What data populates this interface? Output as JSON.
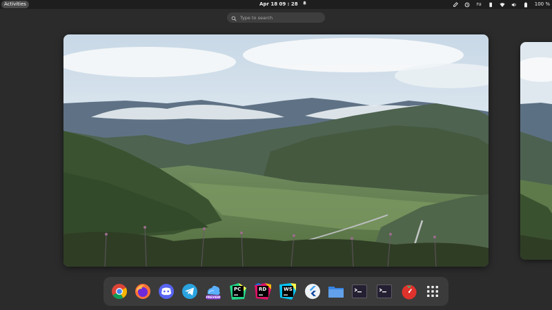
{
  "topbar": {
    "activities_label": "Activities",
    "clock": "Apr 18  09 : 28",
    "tray": {
      "keyboard_layout": "ru",
      "battery_percent": "100 %"
    }
  },
  "search": {
    "placeholder": "Type to search"
  },
  "dock": {
    "apps": [
      {
        "name": "Google Chrome",
        "icon": "chrome-icon"
      },
      {
        "name": "Firefox",
        "icon": "firefox-icon"
      },
      {
        "name": "Discord",
        "icon": "discord-icon"
      },
      {
        "name": "Telegram",
        "icon": "telegram-icon"
      },
      {
        "name": "Preview",
        "icon": "preview-icon",
        "badge": "PREVIEW"
      },
      {
        "name": "PyCharm",
        "icon": "pycharm-icon",
        "label": "PC"
      },
      {
        "name": "Rider",
        "icon": "rider-icon",
        "label": "RD"
      },
      {
        "name": "WebStorm",
        "icon": "webstorm-icon",
        "label": "WS"
      },
      {
        "name": "Flutter",
        "icon": "flutter-icon"
      },
      {
        "name": "Files",
        "icon": "folder-icon"
      },
      {
        "name": "Terminal",
        "icon": "terminal-icon"
      },
      {
        "name": "Terminal 2",
        "icon": "terminal-icon"
      },
      {
        "name": "Tomato",
        "icon": "tomato-timer-icon"
      },
      {
        "name": "Show Applications",
        "icon": "app-grid-icon"
      }
    ]
  },
  "colors": {
    "topbar": "#1e1e1e",
    "background": "#2b2b2b",
    "dock": "#3b3b3b",
    "search": "#3e3e3e"
  }
}
